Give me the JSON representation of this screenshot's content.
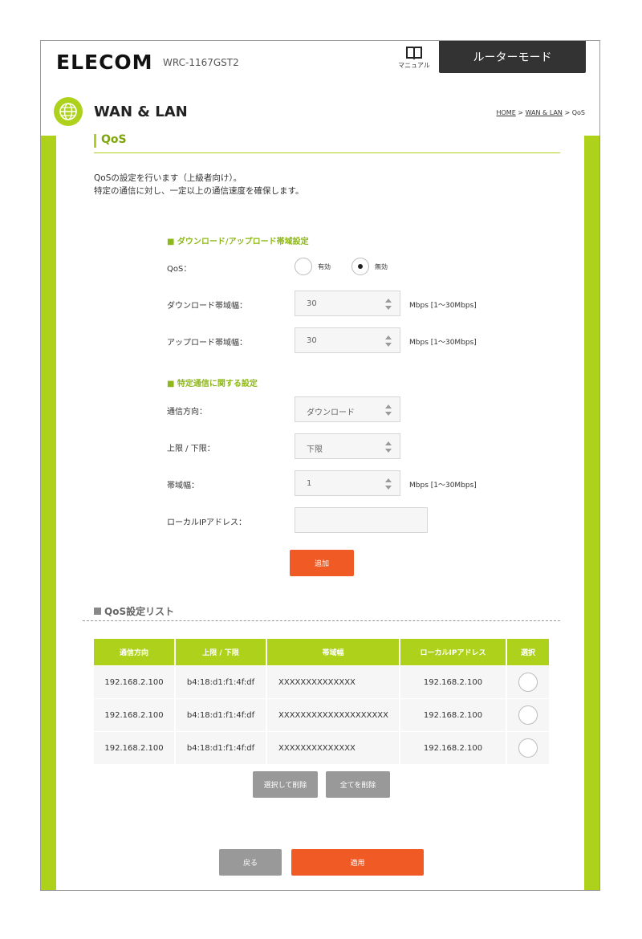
{
  "header": {
    "brand": "ELECOM",
    "model": "WRC-1167GST2",
    "manual_label": "マニュアル",
    "mode_label": "ルーターモード"
  },
  "page": {
    "title": "WAN & LAN",
    "breadcrumb": {
      "home": "HOME",
      "sep1": " > ",
      "wanlan": "WAN & LAN",
      "sep2": " > ",
      "current": "QoS"
    },
    "section_title": "QoS",
    "description": [
      "QoSの設定を行います（上級者向け）。",
      "特定の通信に対し、一定以上の通信速度を確保します。"
    ]
  },
  "bandwidth": {
    "heading": "■ ダウンロード/アップロード帯域設定",
    "qos_label": "QoS：",
    "qos_on_label": "有効",
    "qos_off_label": "無効",
    "qos_value": "無効",
    "download_label": "ダウンロード帯域幅：",
    "download_value": "30",
    "upload_label": "アップロード帯域幅：",
    "upload_value": "30",
    "unit": "Mbps [1～30Mbps]"
  },
  "specific": {
    "heading": "■ 特定通信に関する設定",
    "direction_label": "通信方向：",
    "direction_value": "ダウンロード",
    "limit_label": "上限 / 下限：",
    "limit_value": "下限",
    "bandwidth_label": "帯域幅：",
    "bandwidth_value": "1",
    "unit": "Mbps [1～30Mbps]",
    "ip_label": "ローカルIPアドレス：",
    "ip_value": "",
    "add_button": "追加"
  },
  "list": {
    "heading": "QoS設定リスト",
    "columns": [
      "通信方向",
      "上限 / 下限",
      "帯域幅",
      "ローカルIPアドレス",
      "選択"
    ],
    "rows": [
      [
        "192.168.2.100",
        "b4:18:d1:f1:4f:df",
        "XXXXXXXXXXXXXX",
        "192.168.2.100"
      ],
      [
        "192.168.2.100",
        "b4:18:d1:f1:4f:df",
        "XXXXXXXXXXXXXXXXXXXX",
        "192.168.2.100"
      ],
      [
        "192.168.2.100",
        "b4:18:d1:f1:4f:df",
        "XXXXXXXXXXXXXX",
        "192.168.2.100"
      ]
    ],
    "delete_selected": "選択して削除",
    "delete_all": "全てを削除"
  },
  "footer": {
    "back": "戻る",
    "apply": "適用"
  },
  "colors": {
    "accent": "#aed11b",
    "action": "#f05a24",
    "neutral_button": "#999999",
    "header_dark": "#333333"
  }
}
